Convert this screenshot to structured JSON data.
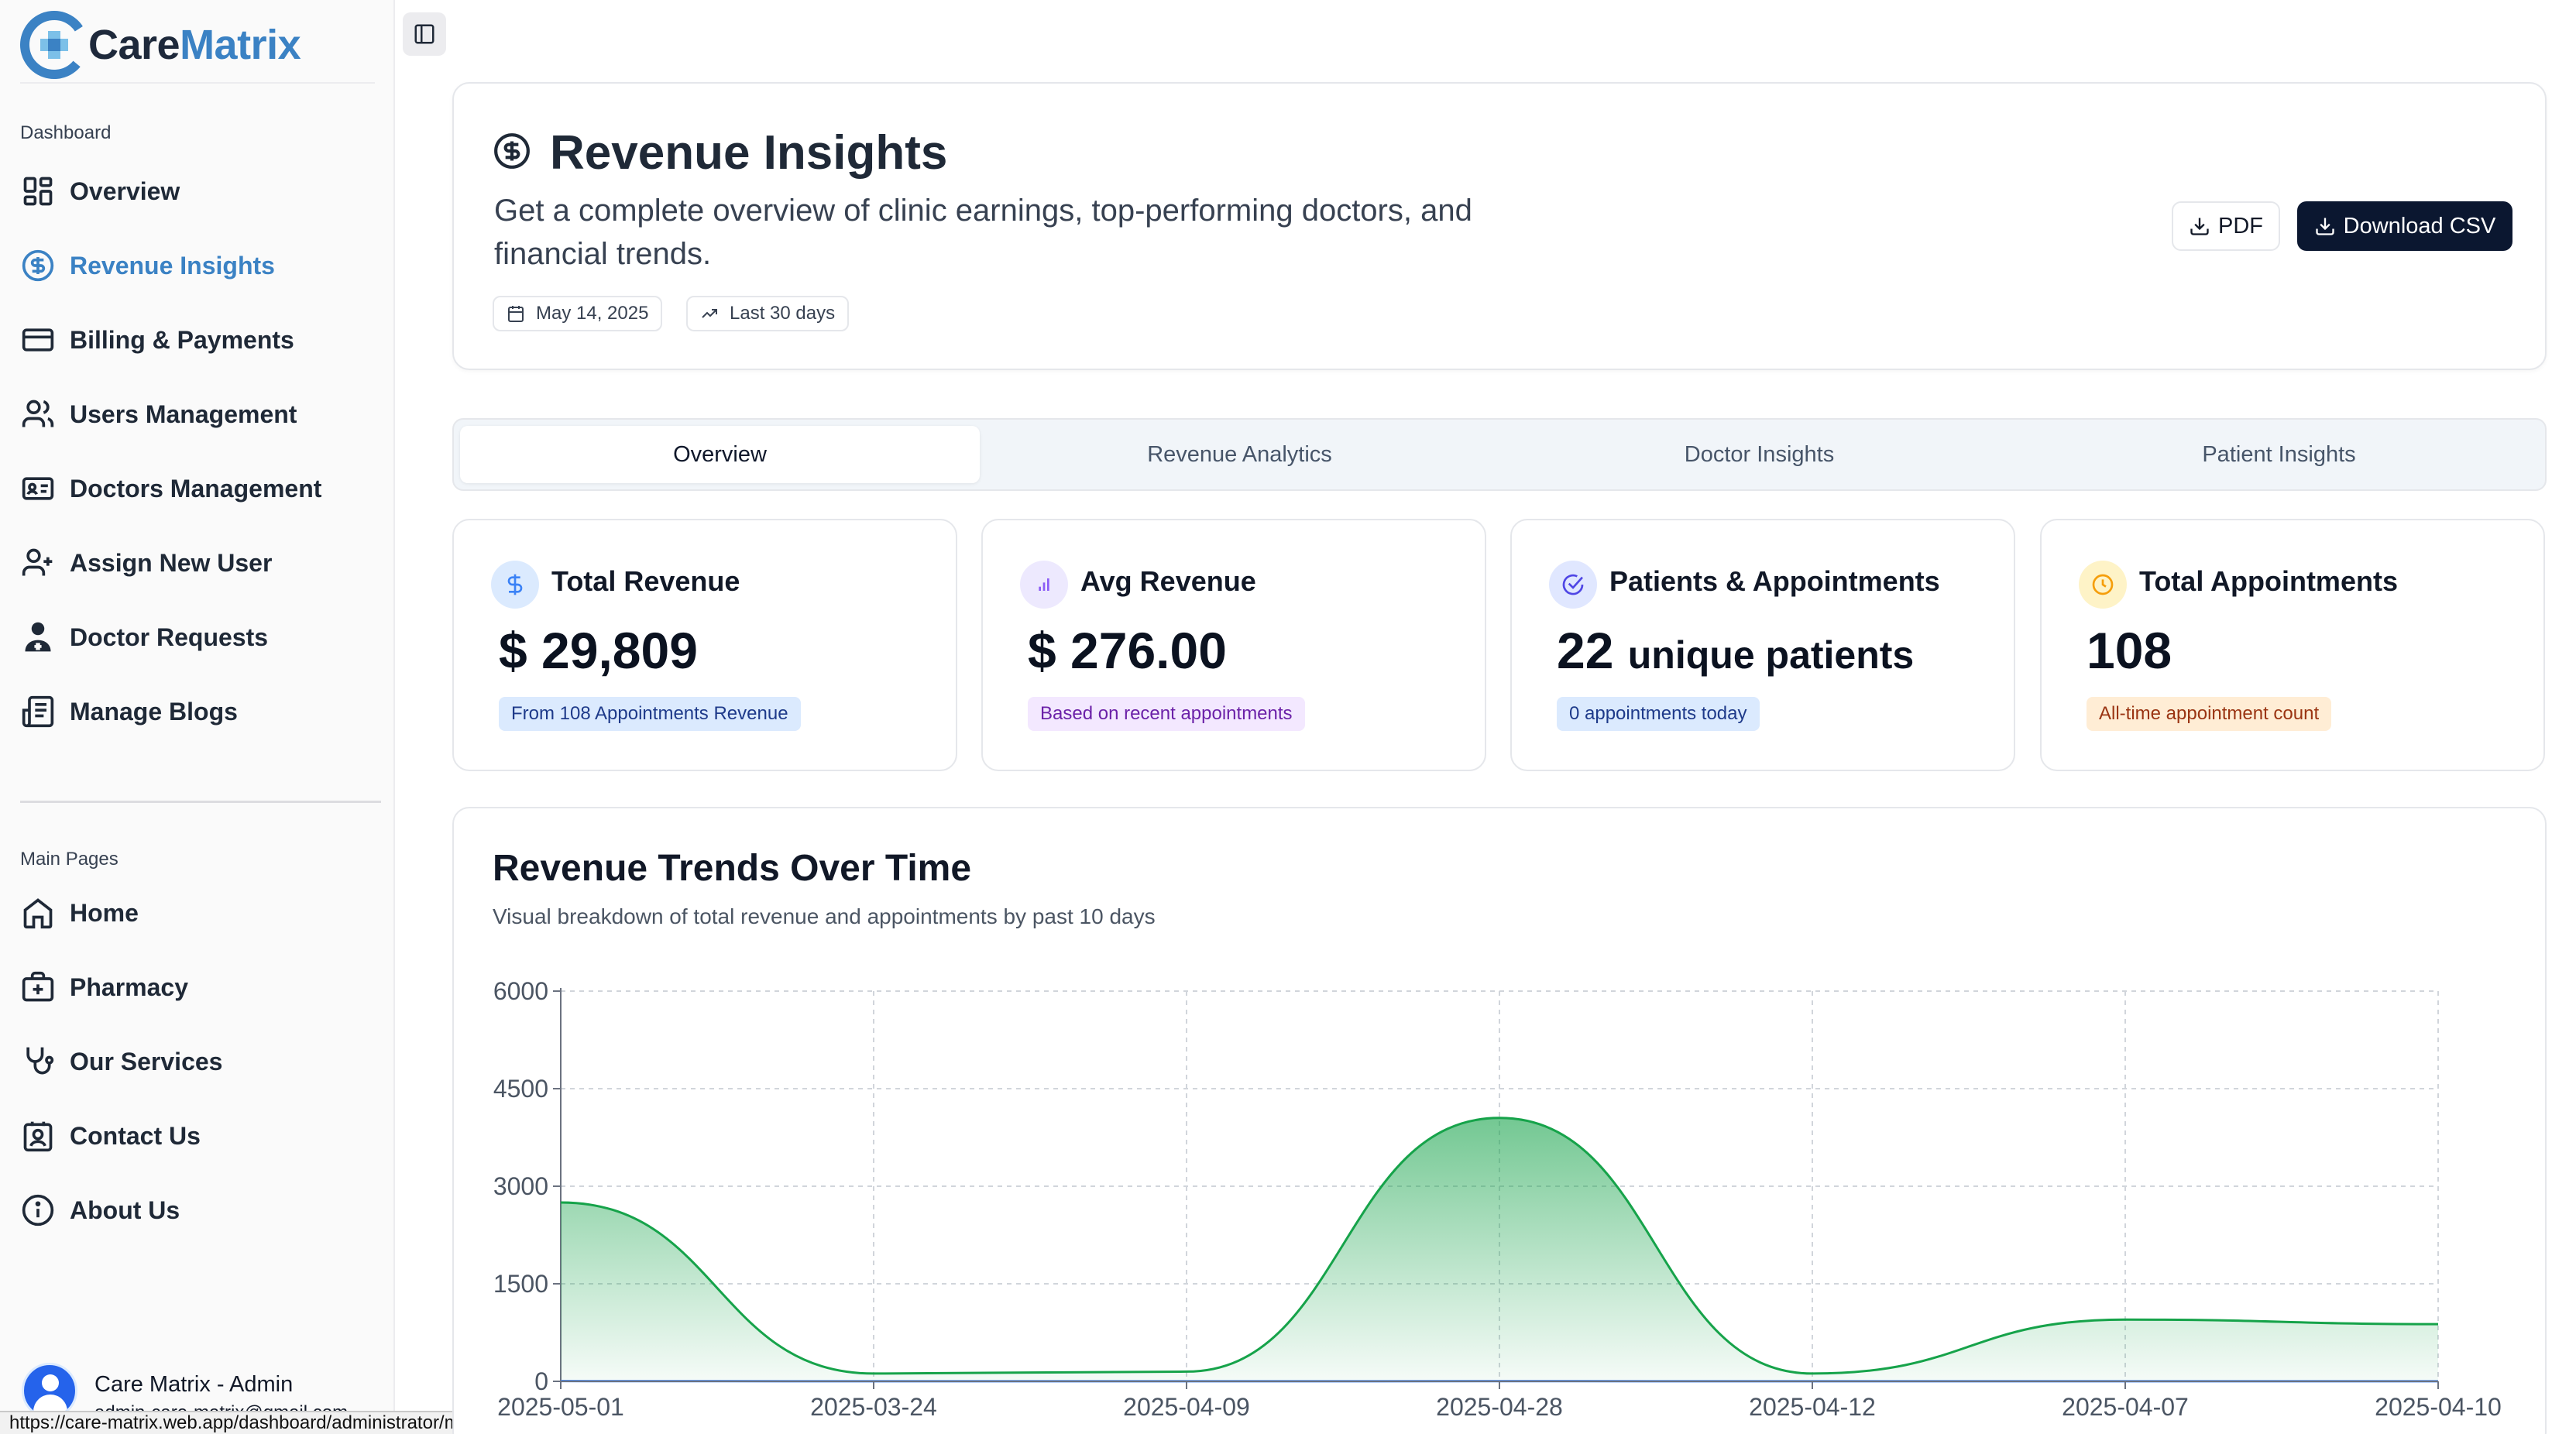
{
  "brand": {
    "name_part1": "Care",
    "name_part2": "Matrix",
    "colors": {
      "primary": "#3b82c4",
      "dark": "#0b1730",
      "green": "#16a34a"
    }
  },
  "sidebar": {
    "group1_label": "Dashboard",
    "group1": [
      {
        "label": "Overview",
        "icon": "grid-icon"
      },
      {
        "label": "Revenue Insights",
        "icon": "dollar-circle-icon",
        "active": true
      },
      {
        "label": "Billing & Payments",
        "icon": "credit-card-icon"
      },
      {
        "label": "Users Management",
        "icon": "users-icon"
      },
      {
        "label": "Doctors Management",
        "icon": "id-card-icon"
      },
      {
        "label": "Assign New User",
        "icon": "user-plus-icon"
      },
      {
        "label": "Doctor Requests",
        "icon": "doctor-icon"
      },
      {
        "label": "Manage Blogs",
        "icon": "newspaper-icon"
      }
    ],
    "group2_label": "Main Pages",
    "group2": [
      {
        "label": "Home",
        "icon": "home-icon"
      },
      {
        "label": "Pharmacy",
        "icon": "briefcase-medical-icon"
      },
      {
        "label": "Our Services",
        "icon": "stethoscope-icon"
      },
      {
        "label": "Contact Us",
        "icon": "contact-icon"
      },
      {
        "label": "About Us",
        "icon": "info-icon"
      }
    ],
    "user": {
      "name": "Care Matrix - Admin",
      "email": "admin-care-matrix@gmail.com"
    }
  },
  "status_bar": {
    "url": "https://care-matrix.web.app/dashboard/administrator/manage-doctors"
  },
  "header": {
    "title": "Revenue Insights",
    "subtitle": "Get a complete overview of clinic earnings, top-performing doctors, and financial trends.",
    "date_chip": "May 14, 2025",
    "range_chip": "Last 30 days",
    "pdf_label": "PDF",
    "csv_label": "Download CSV"
  },
  "tabs": [
    {
      "label": "Overview",
      "active": true
    },
    {
      "label": "Revenue Analytics"
    },
    {
      "label": "Doctor Insights"
    },
    {
      "label": "Patient Insights"
    }
  ],
  "stats": [
    {
      "title": "Total Revenue",
      "value": "$ 29,809",
      "suffix": "",
      "badge": "From 108 Appointments Revenue",
      "icon": "dollar-icon",
      "icon_bg": "#dbeafe",
      "icon_color": "#3b82f6",
      "badge_bg": "#dbeafe",
      "badge_color": "#1e3a8a"
    },
    {
      "title": "Avg Revenue",
      "value": "$ 276.00",
      "suffix": "",
      "badge": "Based on recent appointments",
      "icon": "bar-chart-icon",
      "icon_bg": "#ede9fe",
      "icon_color": "#8b5cf6",
      "badge_bg": "#f3e8ff",
      "badge_color": "#6b21a8"
    },
    {
      "title": "Patients & Appointments",
      "value": "22",
      "suffix": "unique patients",
      "badge": "0 appointments today",
      "icon": "check-circle-icon",
      "icon_bg": "#e0e7ff",
      "icon_color": "#4f46e5",
      "badge_bg": "#dbeafe",
      "badge_color": "#1e3a8a"
    },
    {
      "title": "Total Appointments",
      "value": "108",
      "suffix": "",
      "badge": "All-time appointment count",
      "icon": "clock-icon",
      "icon_bg": "#fef3c7",
      "icon_color": "#f59e0b",
      "badge_bg": "#ffedd5",
      "badge_color": "#9a3412"
    }
  ],
  "chart": {
    "title": "Revenue Trends Over Time",
    "subtitle": "Visual breakdown of total revenue and appointments by past 10 days"
  },
  "chart_data": {
    "type": "area",
    "categories": [
      "2025-05-01",
      "2025-03-24",
      "2025-04-09",
      "2025-04-28",
      "2025-04-12",
      "2025-04-07",
      "2025-04-10"
    ],
    "series": [
      {
        "values": [
          2750,
          120,
          150,
          4050,
          120,
          950,
          880
        ],
        "color": "#16a34a"
      },
      {
        "values": [
          4,
          1,
          1,
          3,
          1,
          2,
          2
        ],
        "color": "#3b82f6"
      }
    ],
    "yticks": [
      0,
      1500,
      3000,
      4500,
      6000
    ],
    "ylim": [
      0,
      6000
    ],
    "grid": true
  }
}
